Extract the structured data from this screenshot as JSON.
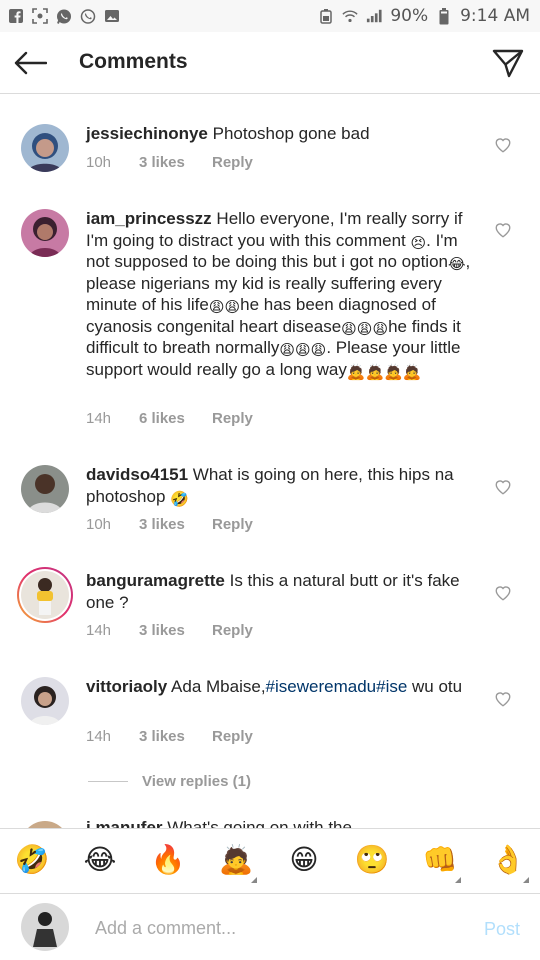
{
  "status_bar": {
    "battery": "90%",
    "time": "9:14 AM",
    "left_icons": [
      "facebook-icon",
      "screenshot-icon",
      "whatsapp-icon",
      "whatsapp-business-icon",
      "gallery-icon"
    ],
    "right_icons": [
      "data-saver-icon",
      "wifi-icon",
      "signal-icon",
      "battery-icon"
    ]
  },
  "header": {
    "title": "Comments",
    "back_icon": "arrow-left-icon",
    "share_icon": "paper-plane-icon"
  },
  "comments": [
    {
      "username": "jessiechinonye",
      "text": "Photoshop gone bad",
      "time": "10h",
      "likes": "3 likes",
      "reply": "Reply"
    },
    {
      "username": "iam_princesszz",
      "text_parts": [
        "Hello everyone, I'm really sorry if I'm going to distract you with this comment ",
        "😣",
        ". I'm not supposed to be doing this but i got no option",
        "😂",
        ", please nigerians my kid is really suffering every minute of his life",
        "😩😩",
        "he has been diagnosed of cyanosis congenital heart disease",
        "😩😩😩",
        "he finds it difficult to breath normally",
        "😩😩😩",
        ". Please your little support would really go a long way",
        "🙇🙇🙇🙇"
      ],
      "time": "14h",
      "likes": "6 likes",
      "reply": "Reply"
    },
    {
      "username": "davidso4151",
      "text": "What is going on here, this hips na photoshop",
      "emoji": "🤣",
      "time": "10h",
      "likes": "3 likes",
      "reply": "Reply"
    },
    {
      "username": "banguramagrette",
      "text": "Is this a natural butt or it's fake one ?",
      "time": "14h",
      "likes": "3 likes",
      "reply": "Reply"
    },
    {
      "username": "vittoriaoly",
      "text_pre": "Ada Mbaise,",
      "tag1": "#iseweremadu",
      "tag2": "#ise",
      "text_post": " wu otu",
      "time": "14h",
      "likes": "3 likes",
      "reply": "Reply",
      "view_replies": "View replies (1)"
    }
  ],
  "partial_comment": {
    "username": "i.manufer",
    "text": "What's going on with the"
  },
  "emoji_bar": [
    "🤣",
    "😂",
    "🔥",
    "🙇",
    "😁",
    "🙄",
    "👊",
    "👌"
  ],
  "compose": {
    "placeholder": "Add a comment...",
    "post_label": "Post"
  },
  "colors": {
    "link_blue": "#003569",
    "meta_grey": "#999999",
    "post_disabled": "#b2dffc"
  }
}
